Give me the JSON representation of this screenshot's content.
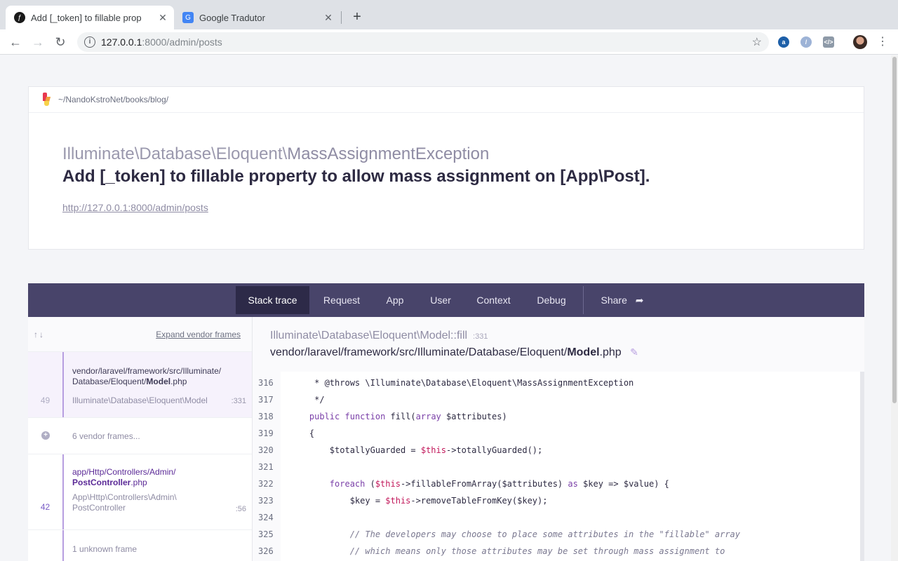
{
  "browser": {
    "tabs": [
      {
        "title": "Add [_token] to fillable prop",
        "active": true,
        "favicon": "symfony-icon"
      },
      {
        "title": "Google Tradutor",
        "active": false,
        "favicon": "google-translate-icon"
      }
    ],
    "url_host": "127.0.0.1",
    "url_path": ":8000/admin/posts"
  },
  "header": {
    "project_path": "~/NandoKstroNet/books/blog/",
    "exception_namespace": "Illuminate\\Database\\Eloquent\\",
    "exception_class": "MassAssignmentException",
    "message": "Add [_token] to fillable property to allow mass assignment on [App\\Post].",
    "url": "http://127.0.0.1:8000/admin/posts"
  },
  "nav": {
    "items": [
      "Stack trace",
      "Request",
      "App",
      "User",
      "Context",
      "Debug"
    ],
    "share": "Share"
  },
  "frames": {
    "expand_label": "Expand vendor frames",
    "f1": {
      "file_a": "vendor/laravel/framework/src/Illuminate/",
      "file_b": "Database/Eloquent/",
      "file_bold": "Model",
      "file_ext": ".php",
      "number": "49",
      "class": "Illuminate\\Database\\Eloquent\\Model",
      "line": ":331"
    },
    "vendor": {
      "label": "6 vendor frames..."
    },
    "f2": {
      "file_a": "app/Http/Controllers/Admin/",
      "file_bold": "PostController",
      "file_ext": ".php",
      "number": "42",
      "class_a": "App\\Http\\Controllers\\Admin\\",
      "class_b": "PostController",
      "line": ":56"
    },
    "unknown": {
      "label": "1 unknown frame"
    }
  },
  "code": {
    "method": "Illuminate\\Database\\Eloquent\\Model::fill",
    "method_line": ":331",
    "file_prefix": "vendor/laravel/framework/src/Illuminate/Database/Eloquent/",
    "file_bold": "Model",
    "file_ext": ".php",
    "lines": [
      {
        "n": "316",
        "text": "     * @throws \\Illuminate\\Database\\Eloquent\\MassAssignmentException"
      },
      {
        "n": "317",
        "text": "     */"
      },
      {
        "n": "318",
        "text": "    public function fill(array $attributes)"
      },
      {
        "n": "319",
        "text": "    {"
      },
      {
        "n": "320",
        "text": "        $totallyGuarded = $this->totallyGuarded();"
      },
      {
        "n": "321",
        "text": ""
      },
      {
        "n": "322",
        "text": "        foreach ($this->fillableFromArray($attributes) as $key => $value) {"
      },
      {
        "n": "323",
        "text": "            $key = $this->removeTableFromKey($key);"
      },
      {
        "n": "324",
        "text": ""
      },
      {
        "n": "325",
        "text": "            // The developers may choose to place some attributes in the \"fillable\" array"
      },
      {
        "n": "326",
        "text": "            // which means only those attributes may be set through mass assignment to"
      }
    ]
  }
}
